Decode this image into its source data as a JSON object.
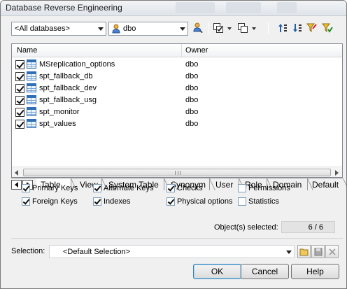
{
  "window": {
    "title": "Database Reverse Engineering"
  },
  "toolbar": {
    "database_filter": "<All databases>",
    "owner_filter": "dbo",
    "icons": [
      "select-owner-icon",
      "select-all-icon",
      "deselect-all-icon",
      "move-up-icon",
      "move-down-icon",
      "filter-icon",
      "use-filter-icon"
    ]
  },
  "list": {
    "columns": [
      "Name",
      "Owner"
    ],
    "rows": [
      {
        "name": "MSreplication_options",
        "owner": "dbo",
        "checked": true
      },
      {
        "name": "spt_fallback_db",
        "owner": "dbo",
        "checked": true
      },
      {
        "name": "spt_fallback_dev",
        "owner": "dbo",
        "checked": true
      },
      {
        "name": "spt_fallback_usg",
        "owner": "dbo",
        "checked": true
      },
      {
        "name": "spt_monitor",
        "owner": "dbo",
        "checked": true
      },
      {
        "name": "spt_values",
        "owner": "dbo",
        "checked": true
      }
    ]
  },
  "tabs": [
    "Table",
    "View",
    "System Table",
    "Synonym",
    "User",
    "Role",
    "Domain",
    "Default"
  ],
  "active_tab": "Table",
  "options": [
    {
      "label": "Primary Keys",
      "checked": true
    },
    {
      "label": "Alternate Keys",
      "checked": true
    },
    {
      "label": "Checks",
      "checked": true
    },
    {
      "label": "Permissions",
      "checked": false
    },
    {
      "label": "Foreign Keys",
      "checked": true
    },
    {
      "label": "Indexes",
      "checked": true
    },
    {
      "label": "Physical options",
      "checked": true
    },
    {
      "label": "Statistics",
      "checked": false
    }
  ],
  "status": {
    "label": "Object(s) selected:",
    "count": "6 / 6"
  },
  "selection": {
    "label": "Selection:",
    "value": "<Default Selection>"
  },
  "buttons": {
    "ok": "OK",
    "cancel": "Cancel",
    "help": "Help"
  }
}
